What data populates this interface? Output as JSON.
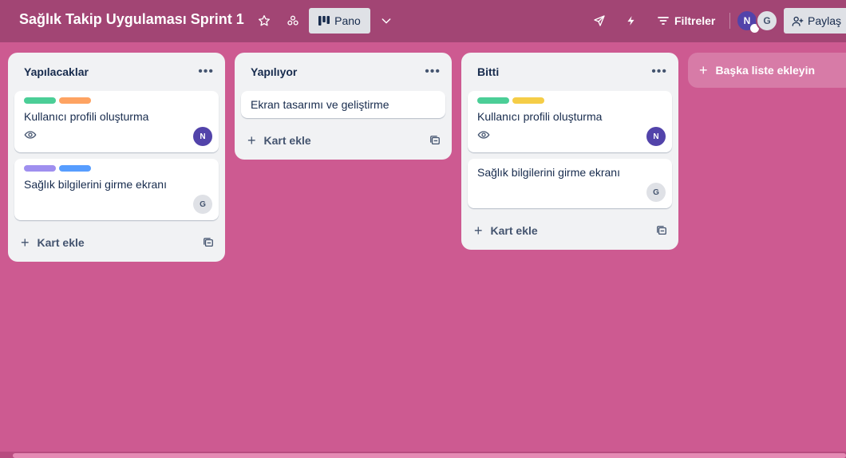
{
  "header": {
    "board_title": "Sağlık Takip Uygulaması Sprint 1",
    "view_label": "Pano",
    "filter_label": "Filtreler",
    "members": [
      "N",
      "G"
    ],
    "share_label": "Paylaş",
    "icons": [
      "star-icon",
      "workspace-visibility-icon",
      "board-view-icon",
      "chevron-down-icon",
      "send-icon",
      "automation-bolt-icon",
      "filter-icon",
      "add-person-icon"
    ]
  },
  "lists": [
    {
      "title": "Yapılacaklar",
      "cards": [
        {
          "title": "Kullanıcı profili oluşturma",
          "labels": [
            "#4bce97",
            "#fea362"
          ],
          "watching": true,
          "member": "N"
        },
        {
          "title": "Sağlık bilgilerini girme ekranı",
          "labels": [
            "#9f8fef",
            "#579dff"
          ],
          "watching": false,
          "member": "G"
        }
      ],
      "add_card_label": "Kart ekle"
    },
    {
      "title": "Yapılıyor",
      "cards": [
        {
          "title": "Ekran tasarımı ve geliştirme",
          "labels": [],
          "watching": false,
          "member": ""
        }
      ],
      "add_card_label": "Kart ekle"
    },
    {
      "title": "Bitti",
      "cards": [
        {
          "title": "Kullanıcı profili oluşturma",
          "labels": [
            "#4bce97",
            "#f5cd47"
          ],
          "watching": true,
          "member": "N"
        },
        {
          "title": "Sağlık bilgilerini girme ekranı",
          "labels": [],
          "watching": false,
          "member": "G"
        }
      ],
      "add_card_label": "Kart ekle"
    }
  ],
  "add_list_label": "Başka liste ekleyin",
  "colors": {
    "board_bg": "#cd5a91",
    "header_bg": "#a24574",
    "member_n": "#5243aa"
  }
}
